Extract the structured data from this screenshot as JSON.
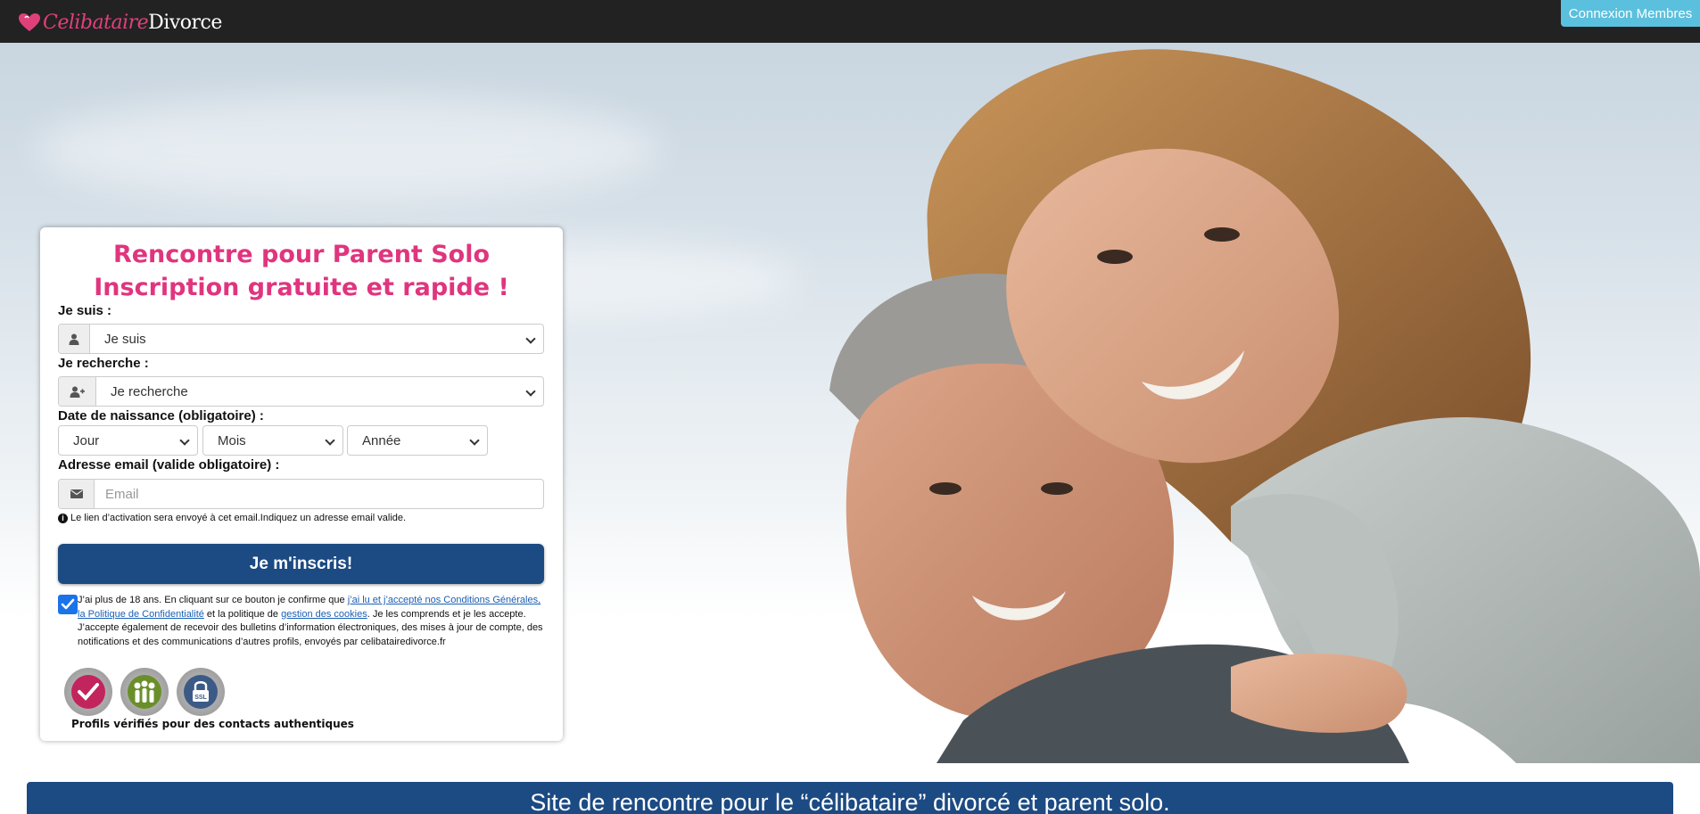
{
  "header": {
    "logo_part1": "Celibataire",
    "logo_part2": "Divorce",
    "login_button": "Connexion Membres",
    "logo_icon": "heart-icon"
  },
  "form": {
    "title_line1": "Rencontre pour Parent Solo",
    "title_line2": "Inscription gratuite et rapide !",
    "gender_label": "Je suis :",
    "gender_value": "Je suis",
    "gender_icon": "user-icon",
    "seeking_label": "Je recherche :",
    "seeking_value": "Je recherche",
    "seeking_icon": "user-plus-icon",
    "birthdate_label": "Date de naissance (obligatoire) :",
    "day_value": "Jour",
    "month_value": "Mois",
    "year_value": "Année",
    "email_label": "Adresse email (valide obligatoire) :",
    "email_placeholder": "Email",
    "email_icon": "envelope-icon",
    "email_hint": "Le lien d’activation sera envoyé à cet email.Indiquez un adresse email valide.",
    "submit_label": "Je m'inscris!",
    "consent_checked": true,
    "consent_text_1": "J’ai plus de 18 ans. En cliquant sur ce bouton je confirme que ",
    "consent_link_1": "j’ai lu et j’accepté nos Conditions Générales, la Politique de Confidentialité",
    "consent_text_2": " et la politique de ",
    "consent_link_2": "gestion des cookies",
    "consent_text_3": ". Je les comprends et je les accepte. J’accepte également de recevoir des bulletins d’information électroniques, des mises à jour de compte, des notifications et des communications d’autres profils, envoyés par celibatairedivorce.fr",
    "badge_ssl_text": "SSL",
    "badges_caption": "Profils vérifiés pour des contacts authentiques"
  },
  "banner": {
    "text": "Site de rencontre pour le “célibataire” divorcé et parent solo."
  },
  "colors": {
    "topbar": "#222222",
    "login_button": "#5bc0de",
    "title_pink": "#e0357e",
    "submit_blue": "#1c4a82",
    "link_blue": "#1a5fb4"
  }
}
